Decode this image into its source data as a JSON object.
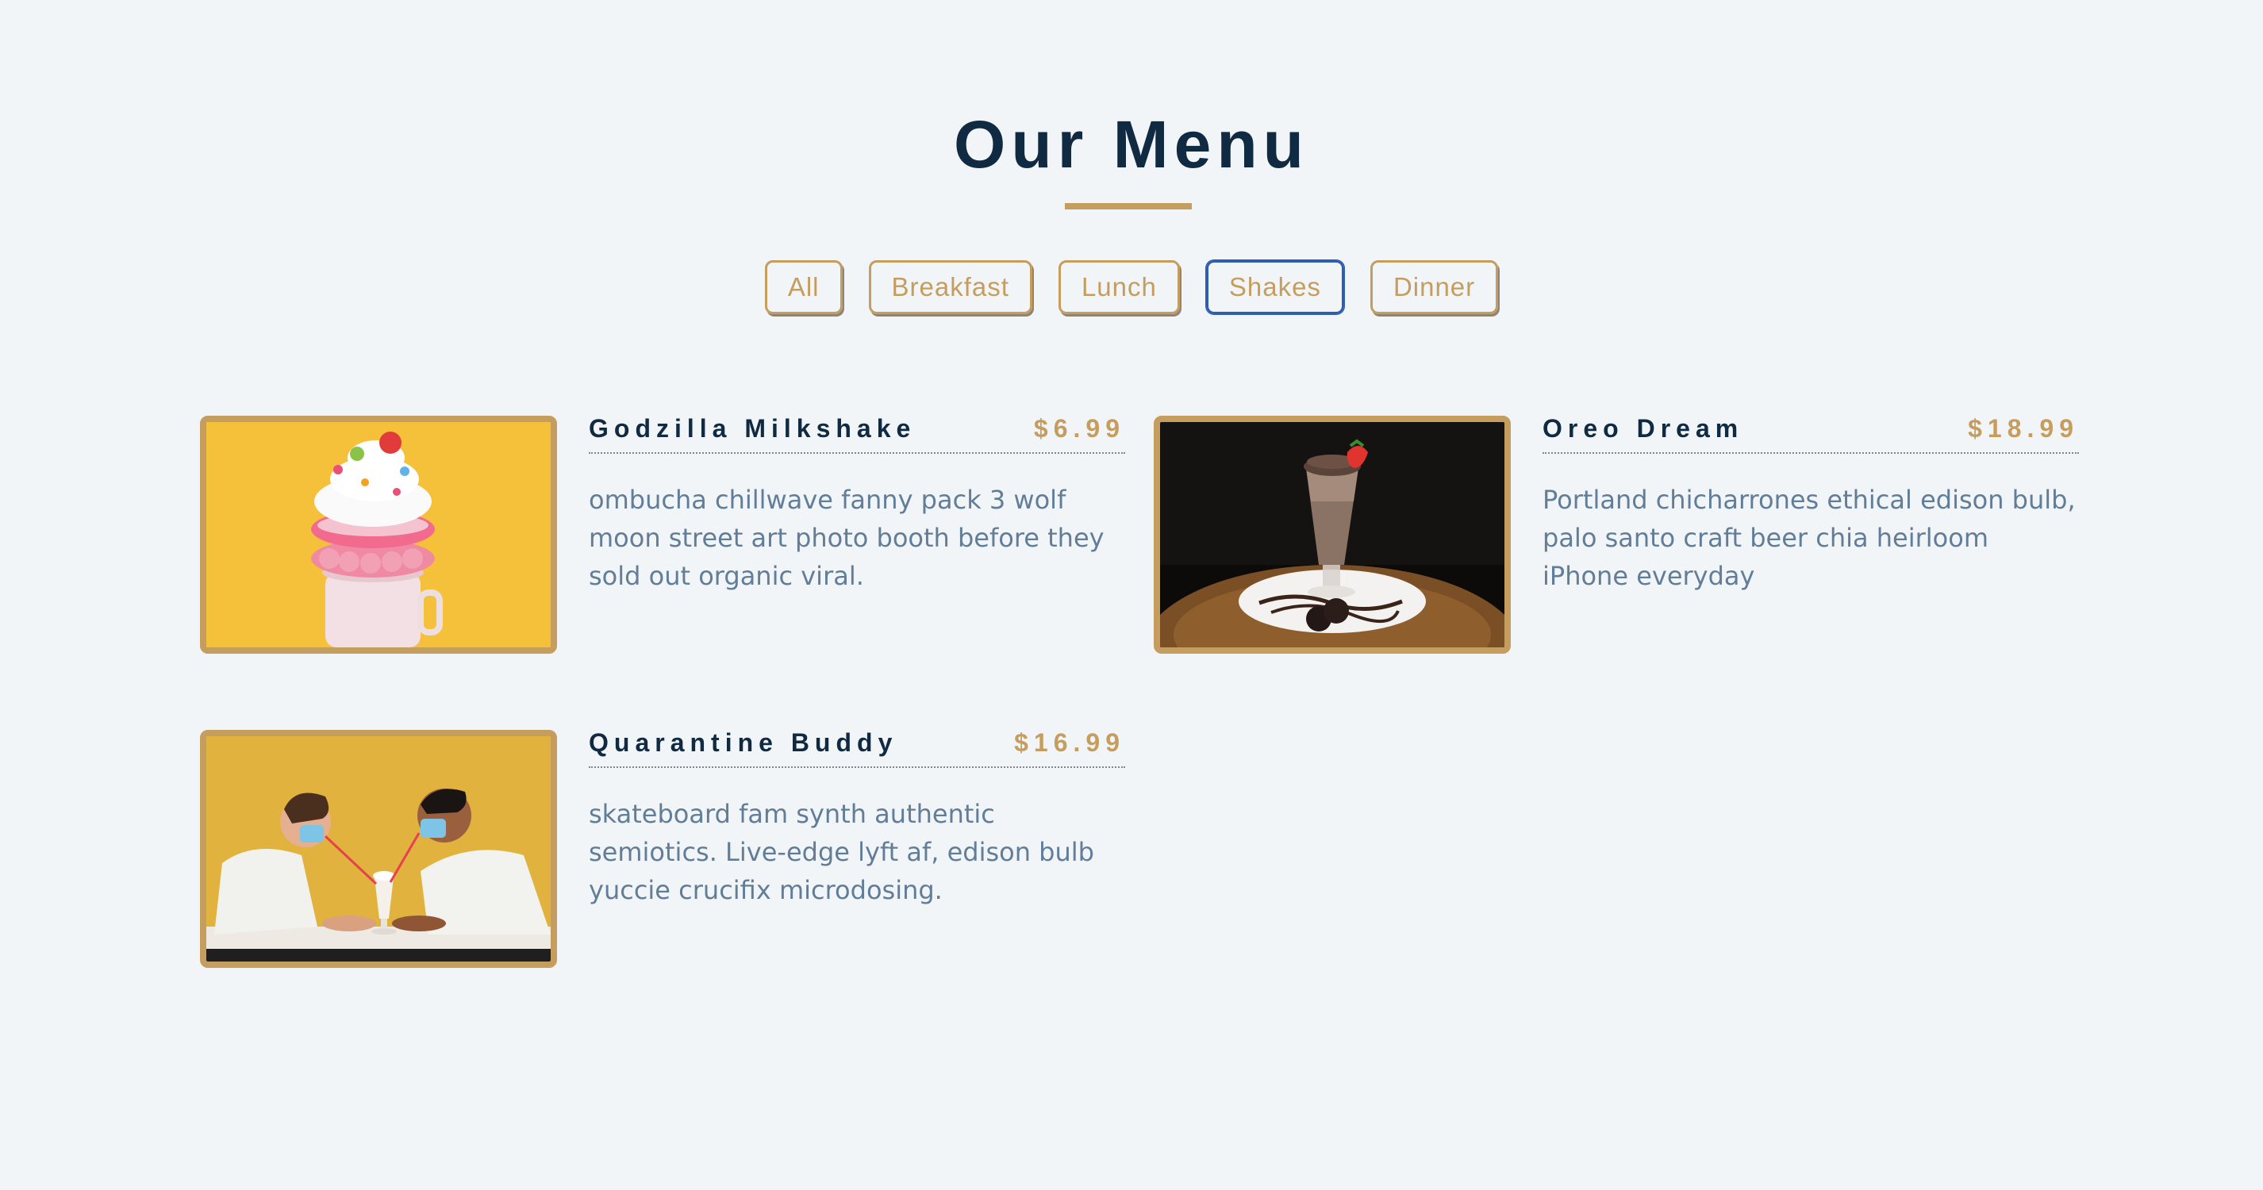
{
  "page": {
    "title": "Our Menu"
  },
  "filters": [
    {
      "label": "All",
      "active": false
    },
    {
      "label": "Breakfast",
      "active": false
    },
    {
      "label": "Lunch",
      "active": false
    },
    {
      "label": "Shakes",
      "active": true
    },
    {
      "label": "Dinner",
      "active": false
    }
  ],
  "items": [
    {
      "name": "Godzilla Milkshake",
      "price": "$6.99",
      "desc": "ombucha chillwave fanny pack 3 wolf moon street art photo booth before they sold out organic viral.",
      "photo": "milkshake-donut-photo"
    },
    {
      "name": "Oreo Dream",
      "price": "$18.99",
      "desc": "Portland chicharrones ethical edison bulb, palo santo craft beer chia heirloom iPhone everyday",
      "photo": "oreo-shake-photo"
    },
    {
      "name": "Quarantine Buddy",
      "price": "$16.99",
      "desc": "skateboard fam synth authentic semiotics. Live-edge lyft af, edison bulb yuccie crucifix microdosing.",
      "photo": "couple-sharing-shake-photo"
    }
  ],
  "colors": {
    "background": "#f1f5f8",
    "accent": "#c59d5f",
    "heading": "#102a42",
    "body_text": "#617d98",
    "active_border": "#2f5db0"
  }
}
